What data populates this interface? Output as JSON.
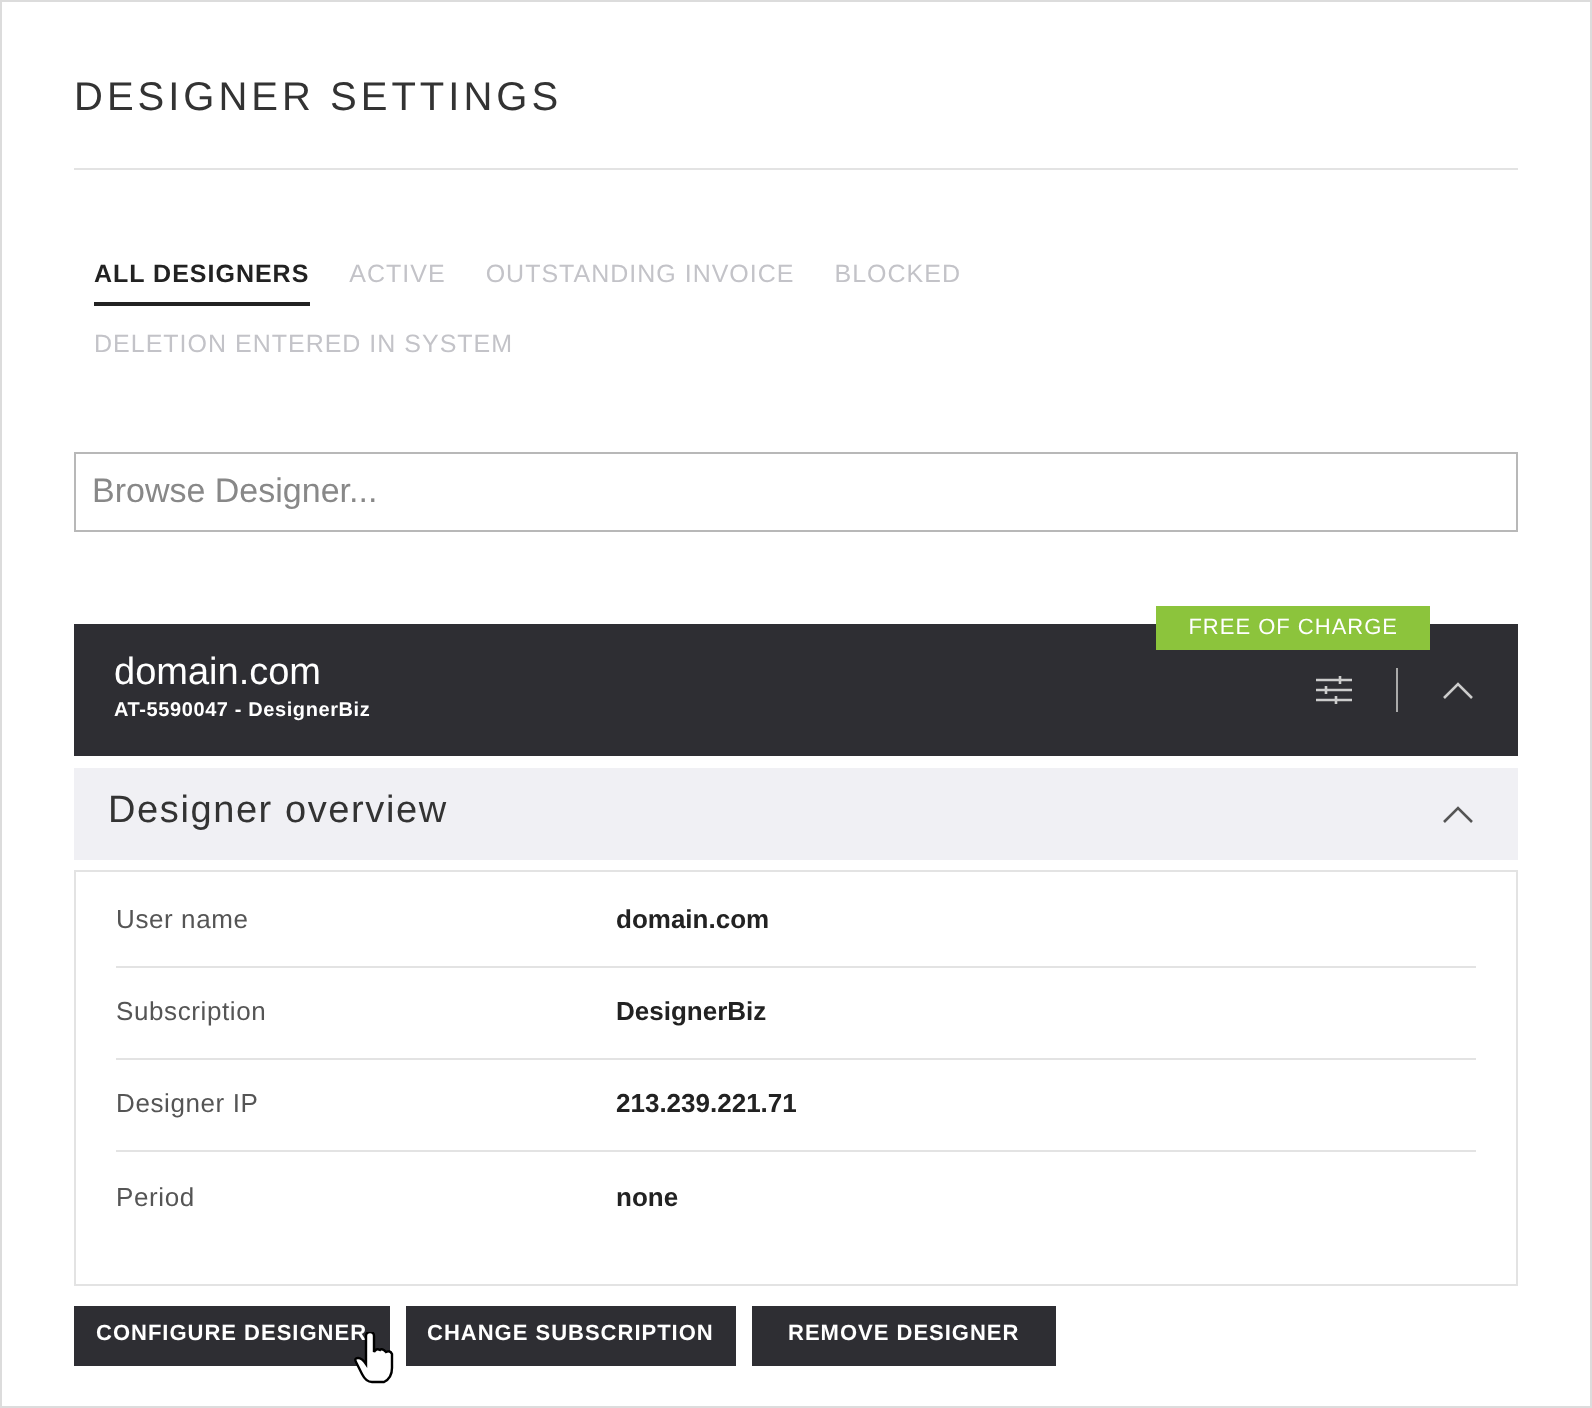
{
  "title": "DESIGNER SETTINGS",
  "tabs": [
    {
      "label": "ALL DESIGNERS",
      "selected": true
    },
    {
      "label": "ACTIVE",
      "selected": false
    },
    {
      "label": "OUTSTANDING INVOICE",
      "selected": false
    },
    {
      "label": "BLOCKED",
      "selected": false
    },
    {
      "label": "DELETION ENTERED IN SYSTEM",
      "selected": false
    }
  ],
  "search": {
    "placeholder": "Browse Designer..."
  },
  "designer": {
    "name": "domain.com",
    "subtitle": "AT-5590047 - DesignerBiz",
    "badge": "FREE OF CHARGE",
    "expanded": true
  },
  "overview": {
    "title": "Designer overview",
    "expanded": true,
    "rows": [
      {
        "label": "User name",
        "value": "domain.com"
      },
      {
        "label": "Subscription",
        "value": "DesignerBiz"
      },
      {
        "label": "Designer IP",
        "value": "213.239.221.71"
      },
      {
        "label": "Period",
        "value": "none"
      }
    ]
  },
  "buttons": [
    "CONFIGURE DESIGNER",
    "CHANGE SUBSCRIPTION",
    "REMOVE DESIGNER"
  ]
}
